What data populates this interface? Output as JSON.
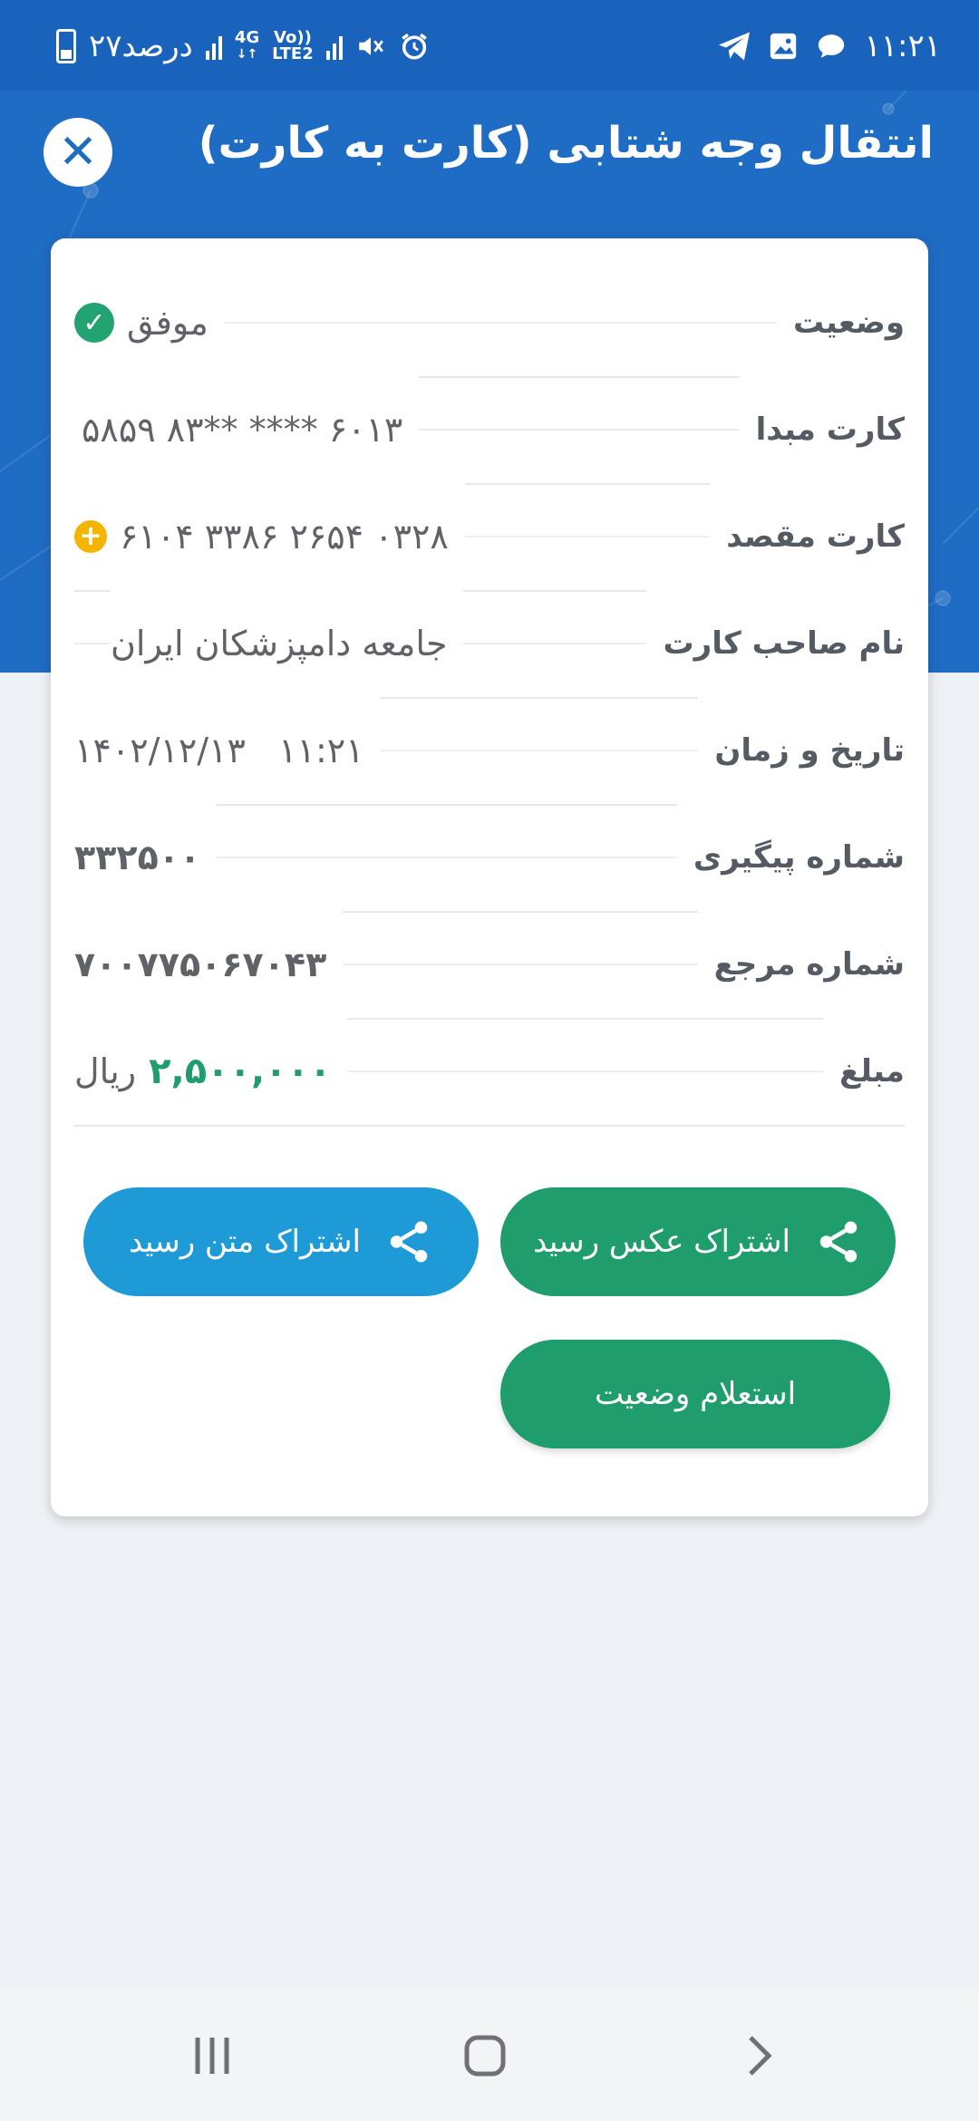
{
  "status_bar": {
    "time": "۱۱:۲۱",
    "battery_text": "۲۷درصد",
    "network_4g": "4G",
    "network_volte": "Vo))",
    "network_lte2": "LTE2",
    "icons": [
      "telegram-icon",
      "gallery-icon",
      "chat-icon",
      "alarm-icon",
      "mute-icon",
      "signal-icon",
      "battery-icon"
    ]
  },
  "header": {
    "title": "انتقال وجه شتابی (کارت به کارت)",
    "close_icon": "close-icon"
  },
  "receipt": {
    "rows": [
      {
        "label": "وضعیت",
        "value": "موفق"
      },
      {
        "label": "کارت مبدا",
        "value": "۵۸۵۹  ۸۳**  ****  ۶۰۱۳"
      },
      {
        "label": "کارت مقصد",
        "value": "۶۱۰۴  ۳۳۸۶  ۲۶۵۴  ۰۳۲۸"
      },
      {
        "label": "نام صاحب کارت",
        "value": "جامعه دامپزشکان ایران"
      },
      {
        "label": "تاریخ و زمان",
        "value": "۱۴۰۲/۱۲/۱۳   ۱۱:۲۱"
      },
      {
        "label": "شماره پیگیری",
        "value": "۳۳۲۵۰۰"
      },
      {
        "label": "شماره مرجع",
        "value": "۷۰۰۷۷۵۰۶۷۰۴۳"
      },
      {
        "label": "مبلغ",
        "value": "۲,۵۰۰,۰۰۰",
        "unit": "ریال"
      }
    ]
  },
  "actions": {
    "share_image": "اشتراک عکس رسید",
    "share_text": "اشتراک متن رسید",
    "inquiry": "استعلام وضعیت"
  },
  "colors": {
    "header_blue": "#1f6cc4",
    "success_green": "#1f9d6c",
    "share_blue": "#1e9bd7",
    "warning_yellow": "#f4b400"
  }
}
